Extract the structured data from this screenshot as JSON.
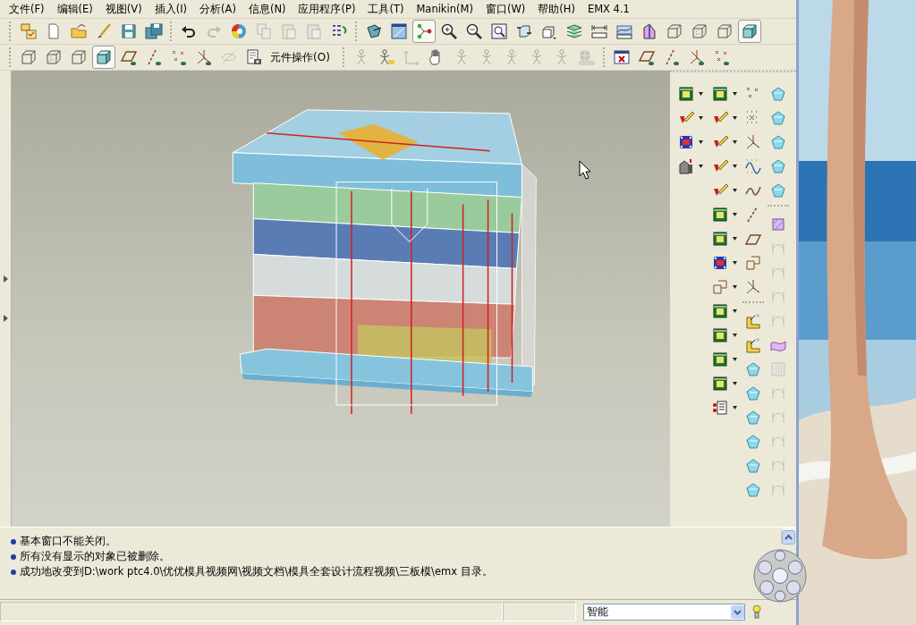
{
  "menu_bar": {
    "items": [
      "文件(F)",
      "编辑(E)",
      "视图(V)",
      "插入(I)",
      "分析(A)",
      "信息(N)",
      "应用程序(P)",
      "工具(T)",
      "Manikin(M)",
      "窗口(W)",
      "帮助(H)",
      "EMX 4.1"
    ]
  },
  "toolbar_1": {
    "buttons": [
      {
        "pressed": false,
        "disabled": false
      },
      {
        "pressed": false,
        "disabled": false
      },
      {
        "pressed": false,
        "disabled": false
      },
      {
        "pressed": false,
        "disabled": false
      },
      {
        "pressed": false,
        "disabled": false
      },
      {
        "pressed": false,
        "disabled": false
      },
      {
        "pressed": false,
        "disabled": false
      },
      {
        "pressed": false,
        "disabled": true
      },
      {
        "pressed": false,
        "disabled": false
      },
      {
        "pressed": false,
        "disabled": true
      },
      {
        "pressed": false,
        "disabled": true
      },
      {
        "pressed": false,
        "disabled": true
      },
      {
        "pressed": false,
        "disabled": false
      },
      {
        "pressed": false,
        "disabled": false
      },
      {
        "pressed": false,
        "disabled": false
      },
      {
        "pressed": true,
        "disabled": false
      },
      {
        "pressed": false,
        "disabled": false
      },
      {
        "pressed": false,
        "disabled": false
      },
      {
        "pressed": false,
        "disabled": false
      },
      {
        "pressed": false,
        "disabled": false
      },
      {
        "pressed": false,
        "disabled": false
      },
      {
        "pressed": false,
        "disabled": false
      },
      {
        "pressed": false,
        "disabled": false
      },
      {
        "pressed": false,
        "disabled": false
      },
      {
        "pressed": false,
        "disabled": false
      },
      {
        "pressed": false,
        "disabled": false
      },
      {
        "pressed": false,
        "disabled": false
      },
      {
        "pressed": false,
        "disabled": false
      },
      {
        "pressed": true,
        "disabled": false
      }
    ]
  },
  "toolbar_2": {
    "buttons_left": [
      {
        "pressed": false,
        "disabled": false
      },
      {
        "pressed": false,
        "disabled": false
      },
      {
        "pressed": false,
        "disabled": false
      },
      {
        "pressed": true,
        "disabled": false
      },
      {
        "pressed": false,
        "disabled": false
      },
      {
        "pressed": false,
        "disabled": false
      },
      {
        "pressed": false,
        "disabled": false
      },
      {
        "pressed": false,
        "disabled": false
      },
      {
        "pressed": false,
        "disabled": true
      },
      {
        "pressed": false,
        "disabled": false
      }
    ],
    "label": "元件操作(O)",
    "buttons_right": [
      {
        "pressed": false,
        "disabled": true
      },
      {
        "pressed": false,
        "disabled": false
      },
      {
        "pressed": false,
        "disabled": true
      },
      {
        "pressed": false,
        "disabled": false
      },
      {
        "pressed": false,
        "disabled": true
      },
      {
        "pressed": false,
        "disabled": true
      },
      {
        "pressed": false,
        "disabled": true
      },
      {
        "pressed": false,
        "disabled": true
      },
      {
        "pressed": false,
        "disabled": true
      },
      {
        "pressed": false,
        "disabled": true
      },
      {
        "pressed": false,
        "disabled": false
      },
      {
        "pressed": false,
        "disabled": false
      },
      {
        "pressed": false,
        "disabled": false
      },
      {
        "pressed": false,
        "disabled": false
      },
      {
        "pressed": false,
        "disabled": false
      }
    ]
  },
  "feature_toolbar": {
    "columns": [
      {
        "buttons": [
          {
            "disabled": false
          },
          {
            "disabled": false
          },
          {
            "disabled": false
          },
          {
            "disabled": false
          }
        ]
      },
      {
        "buttons": [
          {
            "disabled": false
          },
          {
            "disabled": false
          },
          {
            "disabled": false
          },
          {
            "disabled": false
          },
          {
            "disabled": false
          },
          {
            "disabled": false
          },
          {
            "disabled": false
          },
          {
            "disabled": false
          },
          {
            "disabled": false
          },
          {
            "disabled": false
          },
          {
            "disabled": false
          },
          {
            "disabled": false
          },
          {
            "disabled": false
          },
          {
            "disabled": false
          }
        ]
      },
      {
        "buttons": [
          {
            "disabled": false
          },
          {
            "disabled": false
          },
          {
            "disabled": false
          },
          {
            "disabled": false
          },
          {
            "disabled": false
          },
          {
            "disabled": false
          },
          {
            "disabled": false
          },
          {
            "disabled": false
          },
          {
            "disabled": false
          },
          {
            "disabled": false
          },
          {
            "disabled": false
          },
          {
            "disabled": false
          },
          {
            "disabled": false
          },
          {
            "disabled": false
          },
          {
            "disabled": false
          },
          {
            "disabled": false
          },
          {
            "disabled": false
          }
        ]
      },
      {
        "buttons": [
          {
            "disabled": false
          },
          {
            "disabled": false
          },
          {
            "disabled": false
          },
          {
            "disabled": false
          },
          {
            "disabled": false
          },
          {
            "disabled": false
          },
          {
            "disabled": true
          },
          {
            "disabled": true
          },
          {
            "disabled": true
          },
          {
            "disabled": true
          },
          {
            "disabled": false
          },
          {
            "disabled": true
          },
          {
            "disabled": true
          },
          {
            "disabled": true
          },
          {
            "disabled": true
          },
          {
            "disabled": true
          },
          {
            "disabled": true
          }
        ]
      }
    ]
  },
  "messages": [
    "基本窗口不能关闭。",
    "所有没有显示的对象已被删除。",
    "成功地改变到D:\\work ptc4.0\\优优模具视频网\\视频文档\\模具全套设计流程视频\\三板模\\emx 目录。"
  ],
  "status_bar": {
    "filter": {
      "value": "智能"
    }
  }
}
